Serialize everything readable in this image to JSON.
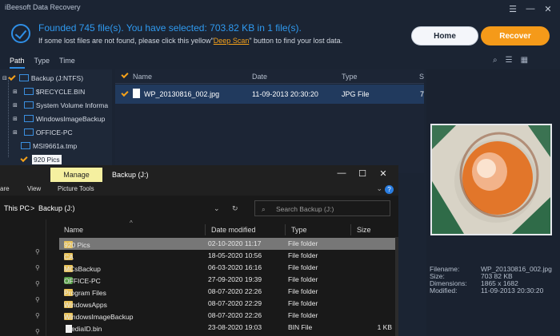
{
  "app": {
    "title": "iBeesoft Data Recovery",
    "found_text": "Founded 745 file(s).  You have selected: 703.82 KB in 1 file(s).",
    "hint_before": "If some lost files are not found, please click this yellow\"",
    "hint_link": "Deep Scan",
    "hint_after": "\" button to find your lost data.",
    "home_label": "Home",
    "recover_label": "Recover",
    "tabs": [
      "Path",
      "Type",
      "Time"
    ],
    "tree": {
      "root": "Backup (J:NTFS)",
      "items": [
        "$RECYCLE.BIN",
        "System Volume Informa",
        "WindowsImageBackup",
        "OFFICE-PC",
        "MSI9661a.tmp",
        "920 Pics"
      ]
    },
    "list": {
      "columns": [
        "Name",
        "Date",
        "Type",
        "S"
      ],
      "row": {
        "name": "WP_20130816_002.jpg",
        "date": "11-09-2013 20:30:20",
        "type": "JPG File",
        "size": "7"
      }
    },
    "meta": {
      "filename_label": "Filename:",
      "filename": "WP_20130816_002.jpg",
      "size_label": "Size:",
      "size": "703 82 KB",
      "dim_label": "Dimensions:",
      "dim": "1865 x 1682",
      "mod_label": "Modified:",
      "mod": "11-09-2013 20:30:20"
    }
  },
  "explorer": {
    "manage": "Manage",
    "title": "Backup (J:)",
    "ribbon": [
      "are",
      "View",
      "Picture Tools"
    ],
    "path": [
      "This PC",
      ">",
      "Backup (J:)"
    ],
    "search_placeholder": "Search Backup (J:)",
    "columns": [
      "Name",
      "Date modified",
      "Type",
      "Size"
    ],
    "rows": [
      {
        "name": "920 Pics",
        "date": "02-10-2020 11:17",
        "type": "File folder",
        "size": ""
      },
      {
        "name": "CA",
        "date": "18-05-2020 10:56",
        "type": "File folder",
        "size": ""
      },
      {
        "name": "MCsBackup",
        "date": "06-03-2020 16:16",
        "type": "File folder",
        "size": ""
      },
      {
        "name": "OFFICE-PC",
        "date": "27-09-2020 19:39",
        "type": "File folder",
        "size": ""
      },
      {
        "name": "Program Files",
        "date": "08-07-2020 22:26",
        "type": "File folder",
        "size": ""
      },
      {
        "name": "WindowsApps",
        "date": "08-07-2020 22:29",
        "type": "File folder",
        "size": ""
      },
      {
        "name": "WindowsImageBackup",
        "date": "08-07-2020 22:26",
        "type": "File folder",
        "size": ""
      },
      {
        "name": "MediaID.bin",
        "date": "23-08-2020 19:03",
        "type": "BIN File",
        "size": "1 KB"
      }
    ]
  },
  "colors": {
    "accent": "#2f8fe6",
    "orange": "#f59a19",
    "bg": "#1b2433"
  }
}
